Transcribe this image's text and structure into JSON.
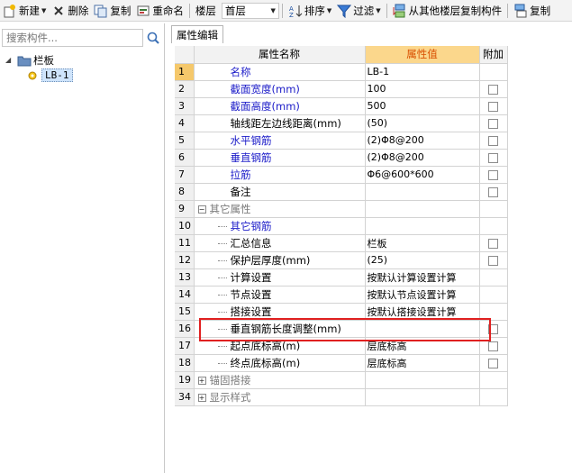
{
  "toolbar": {
    "new_label": "新建",
    "delete_label": "删除",
    "copy_label": "复制",
    "rename_label": "重命名",
    "floor_label": "楼层",
    "floor_value": "首层",
    "sort_label": "排序",
    "filter_label": "过滤",
    "copy_from_floor_label": "从其他楼层复制构件",
    "copy_end_label": "复制"
  },
  "left": {
    "search_placeholder": "搜索构件...",
    "tree_root": "栏板",
    "tree_leaf": "LB-1"
  },
  "tab_label": "属性编辑",
  "grid": {
    "headers": [
      "属性名称",
      "属性值",
      "附加"
    ],
    "rows": [
      {
        "num": "1",
        "name": "名称",
        "value": "LB-1",
        "color": "blue",
        "checkbox": false,
        "selected": true
      },
      {
        "num": "2",
        "name": "截面宽度(mm)",
        "value": "100",
        "color": "blue",
        "checkbox": true
      },
      {
        "num": "3",
        "name": "截面高度(mm)",
        "value": "500",
        "color": "blue",
        "checkbox": true
      },
      {
        "num": "4",
        "name": "轴线距左边线距离(mm)",
        "value": "(50)",
        "color": "black",
        "checkbox": true
      },
      {
        "num": "5",
        "name": "水平钢筋",
        "value": "(2)Φ8@200",
        "color": "blue",
        "checkbox": true
      },
      {
        "num": "6",
        "name": "垂直钢筋",
        "value": "(2)Φ8@200",
        "color": "blue",
        "checkbox": true
      },
      {
        "num": "7",
        "name": "拉筋",
        "value": "Φ6@600*600",
        "color": "blue",
        "checkbox": true
      },
      {
        "num": "8",
        "name": "备注",
        "value": "",
        "color": "black",
        "checkbox": true
      },
      {
        "num": "9",
        "name": "其它属性",
        "value": "",
        "color": "gray",
        "group": "minus"
      },
      {
        "num": "10",
        "name": "其它钢筋",
        "value": "",
        "color": "blue",
        "child": true
      },
      {
        "num": "11",
        "name": "汇总信息",
        "value": "栏板",
        "color": "black",
        "child": true,
        "checkbox": true
      },
      {
        "num": "12",
        "name": "保护层厚度(mm)",
        "value": "(25)",
        "color": "black",
        "child": true,
        "checkbox": true
      },
      {
        "num": "13",
        "name": "计算设置",
        "value": "按默认计算设置计算",
        "color": "black",
        "child": true
      },
      {
        "num": "14",
        "name": "节点设置",
        "value": "按默认节点设置计算",
        "color": "black",
        "child": true
      },
      {
        "num": "15",
        "name": "搭接设置",
        "value": "按默认搭接设置计算",
        "color": "black",
        "child": true
      },
      {
        "num": "16",
        "name": "垂直钢筋长度调整(mm)",
        "value": "",
        "color": "black",
        "child": true,
        "checkbox": true
      },
      {
        "num": "17",
        "name": "起点底标高(m)",
        "value": "层底标高",
        "color": "black",
        "child": true,
        "checkbox": true
      },
      {
        "num": "18",
        "name": "终点底标高(m)",
        "value": "层底标高",
        "color": "black",
        "child": true,
        "checkbox": true
      },
      {
        "num": "19",
        "name": "锚固搭接",
        "value": "",
        "color": "gray",
        "group": "plus"
      },
      {
        "num": "34",
        "name": "显示样式",
        "value": "",
        "color": "gray",
        "group": "plus"
      }
    ]
  }
}
